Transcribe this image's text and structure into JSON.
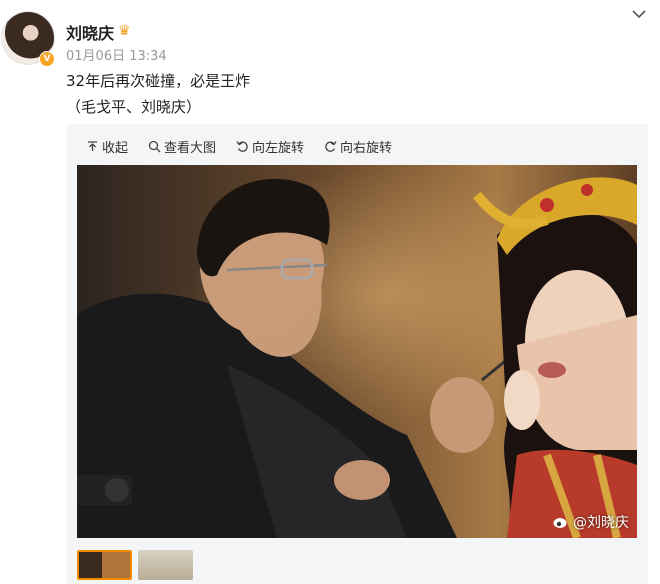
{
  "post": {
    "username": "刘晓庆",
    "date": "01月06日",
    "time": "13:34",
    "text_line1": "32年后再次碰撞，必是王炸",
    "text_line2": "（毛戈平、刘晓庆）"
  },
  "toolbar": {
    "collapse": "收起",
    "view_large": "查看大图",
    "rotate_left": "向左旋转",
    "rotate_right": "向右旋转"
  },
  "watermark": "@刘晓庆",
  "icons": [
    "crown-icon",
    "chevron-down-icon",
    "collapse-icon",
    "zoom-icon",
    "rotate-left-icon",
    "rotate-right-icon",
    "weibo-icon"
  ],
  "colors": {
    "accent": "#f28b00",
    "badge": "#f5a623"
  }
}
